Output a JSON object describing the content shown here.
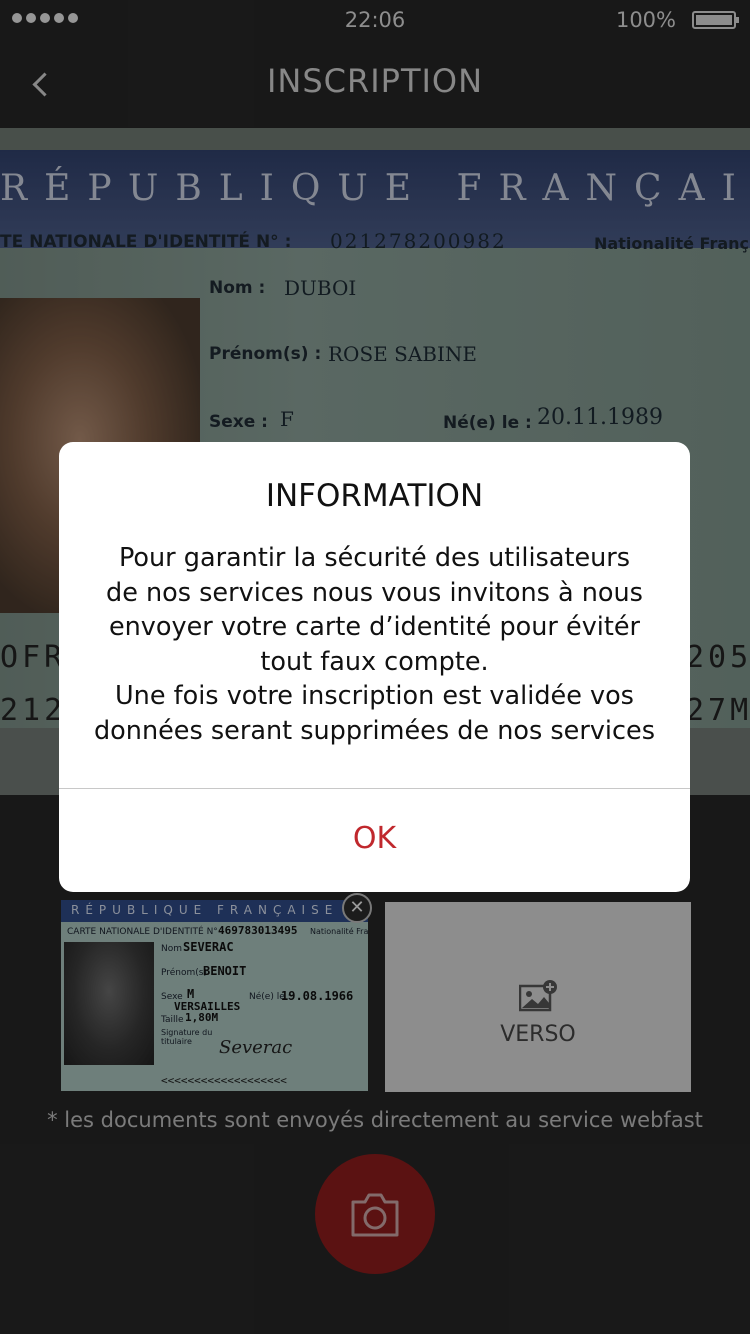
{
  "status_bar": {
    "time": "22:06",
    "battery": "100%"
  },
  "nav": {
    "title": "INSCRIPTION"
  },
  "id_preview": {
    "header": "RÉPUBLIQUE FRANÇAISE",
    "card_number_label": "TE NATIONALE D'IDENTITÉ N° :",
    "card_number": "021278200982",
    "nationality_label": "Nationalité Franç",
    "nom_label": "Nom :",
    "nom": "DUBOI",
    "prenom_label": "Prénom(s) :",
    "prenom": "ROSE SABINE",
    "sexe_label": "Sexe :",
    "sexe": "F",
    "ne_label": "Né(e) le :",
    "ne": "20.11.1989",
    "mrz1_left": "OFRA",
    "mrz1_right": "205",
    "mrz2_left": "212",
    "mrz2_right": "27M"
  },
  "recto_thumb": {
    "header": "RÉPUBLIQUE FRANÇAISE",
    "card_label": "CARTE NATIONALE D'IDENTITÉ N° :",
    "card_number": "469783013495",
    "nationality": "Nationalité Française",
    "nom_label": "Nom",
    "nom": "SEVERAC",
    "prenom_label": "Prénom(s)",
    "prenom": "BENOIT",
    "sexe_label": "Sexe",
    "sexe": "M",
    "ne_label": "Né(e) le :",
    "ne": "19.08.1966",
    "lieu": "VERSAILLES",
    "taille_label": "Taille",
    "taille": "1,80M",
    "signature_label": "Signature du titulaire",
    "signature": "Severac",
    "mrz": "<<<<<<<<<<<<<<<<<<<"
  },
  "verso_thumb": {
    "label": "VERSO"
  },
  "note": "* les documents sont envoyés directement au service webfast",
  "modal": {
    "title": "INFORMATION",
    "lines": [
      "Pour garantir la sécurité des utilisateurs",
      "de nos services nous vous invitons à nous",
      "envoyer votre carte d’identité pour évitér",
      "tout faux compte.",
      "Une fois votre inscription est validée vos",
      "données serant supprimées de nos services"
    ],
    "ok": "OK"
  },
  "colors": {
    "accent": "#c0282d",
    "camera_button": "#8c1d1d",
    "background": "#262626"
  },
  "icons": {
    "back": "chevron-left-icon",
    "camera": "camera-icon",
    "add_image": "add-image-icon",
    "close": "close-icon"
  }
}
